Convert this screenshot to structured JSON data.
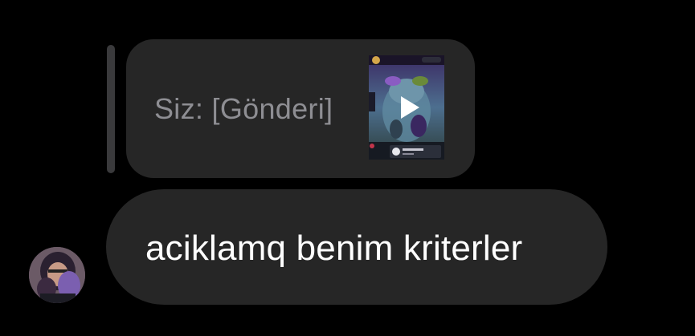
{
  "reply": {
    "prefix": "Siz:",
    "content": "[Gönderi]",
    "thumbnail_icon": "video-post-thumbnail",
    "play_icon": "play-icon"
  },
  "message": {
    "text": "aciklamq benim kriterler"
  },
  "sender": {
    "avatar_icon": "profile-avatar"
  },
  "colors": {
    "background": "#000000",
    "bubble": "#262626",
    "reply_text": "#8e8e93",
    "message_text": "#ffffff",
    "reply_bar": "#3a3a3c"
  }
}
